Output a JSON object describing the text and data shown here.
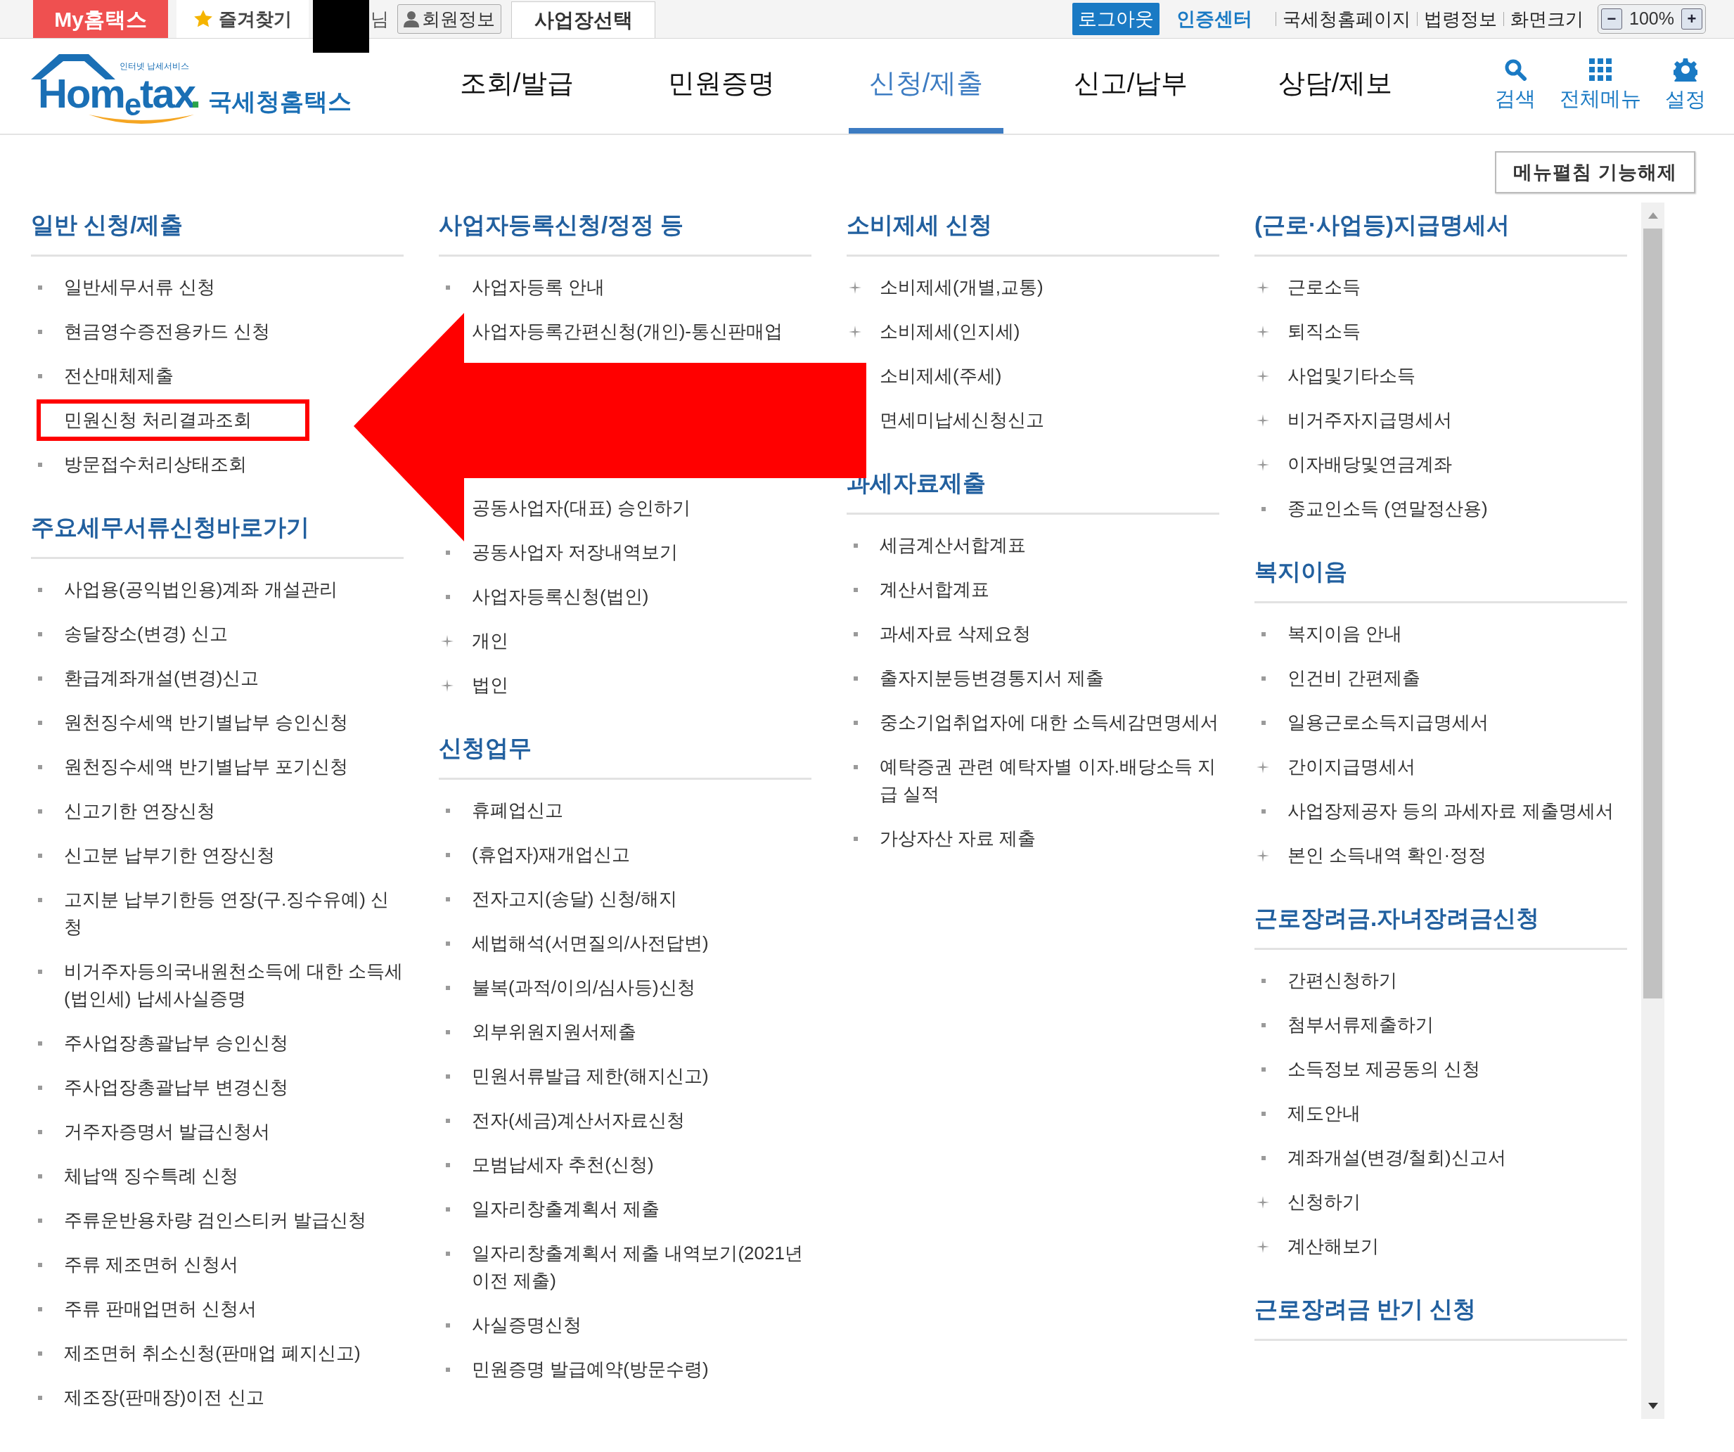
{
  "top_bar": {
    "my_hometax": "My홈택스",
    "favorites": "즐겨찾기",
    "user_suffix": "님",
    "member_info": "회원정보",
    "workplace_select": "사업장선택",
    "logout": "로그아웃",
    "cert_center": "인증센터",
    "links": [
      "국세청홈페이지",
      "법령정보",
      "화면크기"
    ],
    "zoom": {
      "minus": "−",
      "value": "100%",
      "plus": "+"
    }
  },
  "header": {
    "logo": {
      "word": "Hom$_{e}$tax",
      "dot": ".",
      "tagline": "인터넷 납세서비스",
      "name": "국세청홈택스"
    },
    "nav": [
      {
        "label": "조회/발급",
        "selected": false
      },
      {
        "label": "민원증명",
        "selected": false
      },
      {
        "label": "신청/제출",
        "selected": true
      },
      {
        "label": "신고/납부",
        "selected": false
      },
      {
        "label": "상담/제보",
        "selected": false
      }
    ],
    "tools": [
      {
        "kind": "search",
        "label": "검색"
      },
      {
        "kind": "grid",
        "label": "전체메뉴"
      },
      {
        "kind": "gear",
        "label": "설정"
      }
    ]
  },
  "menu_toggle": "메뉴펼침 기능해제",
  "columns": [
    {
      "sections": [
        {
          "title": "일반 신청/제출",
          "items": [
            {
              "label": "일반세무서류 신청",
              "kind": "square",
              "highlighted": false
            },
            {
              "label": "현금영수증전용카드 신청",
              "kind": "square",
              "highlighted": false
            },
            {
              "label": "전산매체제출",
              "kind": "square",
              "highlighted": false
            },
            {
              "label": "민원신청 처리결과조회",
              "kind": "none",
              "highlighted": true
            },
            {
              "label": "방문접수처리상태조회",
              "kind": "square",
              "highlighted": false
            }
          ]
        },
        {
          "title": "주요세무서류신청바로가기",
          "items": [
            {
              "label": "사업용(공익법인용)계좌 개설관리",
              "kind": "square",
              "highlighted": false
            },
            {
              "label": "송달장소(변경) 신고",
              "kind": "square",
              "highlighted": false
            },
            {
              "label": "환급계좌개설(변경)신고",
              "kind": "square",
              "highlighted": false
            },
            {
              "label": "원천징수세액 반기별납부 승인신청",
              "kind": "square",
              "highlighted": false
            },
            {
              "label": "원천징수세액 반기별납부 포기신청",
              "kind": "square",
              "highlighted": false
            },
            {
              "label": "신고기한 연장신청",
              "kind": "square",
              "highlighted": false
            },
            {
              "label": "신고분 납부기한 연장신청",
              "kind": "square",
              "highlighted": false
            },
            {
              "label": "고지분 납부기한등 연장(구.징수유예) 신청",
              "kind": "square",
              "highlighted": false
            },
            {
              "label": "비거주자등의국내원천소득에 대한 소득세(법인세) 납세사실증명",
              "kind": "square",
              "highlighted": false
            },
            {
              "label": "주사업장총괄납부 승인신청",
              "kind": "square",
              "highlighted": false
            },
            {
              "label": "주사업장총괄납부 변경신청",
              "kind": "square",
              "highlighted": false
            },
            {
              "label": "거주자증명서 발급신청서",
              "kind": "square",
              "highlighted": false
            },
            {
              "label": "체납액 징수특례 신청",
              "kind": "square",
              "highlighted": false
            },
            {
              "label": "주류운반용차량 검인스티커 발급신청",
              "kind": "square",
              "highlighted": false
            },
            {
              "label": "주류 제조면허 신청서",
              "kind": "square",
              "highlighted": false
            },
            {
              "label": "주류 판매업면허 신청서",
              "kind": "square",
              "highlighted": false
            },
            {
              "label": "제조면허 취소신청(판매업 폐지신고)",
              "kind": "square",
              "highlighted": false
            },
            {
              "label": "제조장(판매장)이전 신고",
              "kind": "square",
              "highlighted": false
            }
          ]
        }
      ]
    },
    {
      "sections": [
        {
          "title": "사업자등록신청/정정 등",
          "items": [
            {
              "label": "사업자등록 안내",
              "kind": "square",
              "highlighted": false
            },
            {
              "label": "사업자등록간편신청(개인)-통신판매업",
              "kind": "none",
              "highlighted": false
            },
            {
              "label": "공동사업자(대표) 승인하기",
              "kind": "none",
              "highlighted": false
            },
            {
              "label": "공동사업자 저장내역보기",
              "kind": "square",
              "highlighted": false
            },
            {
              "label": "사업자등록신청(법인)",
              "kind": "square",
              "highlighted": false
            },
            {
              "label": "개인",
              "kind": "plus",
              "highlighted": false
            },
            {
              "label": "법인",
              "kind": "plus",
              "highlighted": false
            }
          ]
        },
        {
          "title": "신청업무",
          "items": [
            {
              "label": "휴폐업신고",
              "kind": "square",
              "highlighted": false
            },
            {
              "label": "(휴업자)재개업신고",
              "kind": "square",
              "highlighted": false
            },
            {
              "label": "전자고지(송달) 신청/해지",
              "kind": "square",
              "highlighted": false
            },
            {
              "label": "세법해석(서면질의/사전답변)",
              "kind": "square",
              "highlighted": false
            },
            {
              "label": "불복(과적/이의/심사등)신청",
              "kind": "square",
              "highlighted": false
            },
            {
              "label": "외부위원지원서제출",
              "kind": "square",
              "highlighted": false
            },
            {
              "label": "민원서류발급 제한(해지신고)",
              "kind": "square",
              "highlighted": false
            },
            {
              "label": "전자(세금)계산서자료신청",
              "kind": "square",
              "highlighted": false
            },
            {
              "label": "모범납세자 추천(신청)",
              "kind": "square",
              "highlighted": false
            },
            {
              "label": "일자리창출계획서 제출",
              "kind": "square",
              "highlighted": false
            },
            {
              "label": "일자리창출계획서 제출 내역보기(2021년 이전 제출)",
              "kind": "square",
              "highlighted": false
            },
            {
              "label": "사실증명신청",
              "kind": "square",
              "highlighted": false
            },
            {
              "label": "민원증명 발급예약(방문수령)",
              "kind": "square",
              "highlighted": false
            }
          ]
        }
      ]
    },
    {
      "sections": [
        {
          "title": "소비제세 신청",
          "items": [
            {
              "label": "소비제세(개별,교통)",
              "kind": "plus",
              "highlighted": false
            },
            {
              "label": "소비제세(인지세)",
              "kind": "plus",
              "highlighted": false
            },
            {
              "label": "소비제세(주세)",
              "kind": "none",
              "highlighted": false
            },
            {
              "label": "면세미납세신청신고",
              "kind": "none",
              "highlighted": false
            }
          ]
        },
        {
          "title": "과세자료제출",
          "items": [
            {
              "label": "세금계산서합계표",
              "kind": "square",
              "highlighted": false
            },
            {
              "label": "계산서합계표",
              "kind": "square",
              "highlighted": false
            },
            {
              "label": "과세자료 삭제요청",
              "kind": "square",
              "highlighted": false
            },
            {
              "label": "출자지분등변경통지서 제출",
              "kind": "square",
              "highlighted": false
            },
            {
              "label": "중소기업취업자에 대한 소득세감면명세서",
              "kind": "square",
              "highlighted": false
            },
            {
              "label": "예탁증권 관련 예탁자별 이자.배당소득 지급 실적",
              "kind": "square",
              "highlighted": false
            },
            {
              "label": "가상자산 자료 제출",
              "kind": "square",
              "highlighted": false
            }
          ]
        }
      ]
    },
    {
      "sections": [
        {
          "title": "(근로·사업등)지급명세서",
          "items": [
            {
              "label": "근로소득",
              "kind": "plus",
              "highlighted": false
            },
            {
              "label": "퇴직소득",
              "kind": "plus",
              "highlighted": false
            },
            {
              "label": "사업및기타소득",
              "kind": "plus",
              "highlighted": false
            },
            {
              "label": "비거주자지급명세서",
              "kind": "plus",
              "highlighted": false
            },
            {
              "label": "이자배당및연금계좌",
              "kind": "plus",
              "highlighted": false
            },
            {
              "label": "종교인소득 (연말정산용)",
              "kind": "square",
              "highlighted": false
            }
          ]
        },
        {
          "title": "복지이음",
          "items": [
            {
              "label": "복지이음 안내",
              "kind": "square",
              "highlighted": false
            },
            {
              "label": "인건비 간편제출",
              "kind": "square",
              "highlighted": false
            },
            {
              "label": "일용근로소득지급명세서",
              "kind": "square",
              "highlighted": false
            },
            {
              "label": "간이지급명세서",
              "kind": "plus",
              "highlighted": false
            },
            {
              "label": "사업장제공자 등의 과세자료 제출명세서",
              "kind": "square",
              "highlighted": false
            },
            {
              "label": "본인 소득내역 확인·정정",
              "kind": "plus",
              "highlighted": false
            }
          ]
        },
        {
          "title": "근로장려금.자녀장려금신청",
          "items": [
            {
              "label": "간편신청하기",
              "kind": "square",
              "highlighted": false
            },
            {
              "label": "첨부서류제출하기",
              "kind": "square",
              "highlighted": false
            },
            {
              "label": "소득정보 제공동의 신청",
              "kind": "square",
              "highlighted": false
            },
            {
              "label": "제도안내",
              "kind": "square",
              "highlighted": false
            },
            {
              "label": "계좌개설(변경/철회)신고서",
              "kind": "square",
              "highlighted": false
            },
            {
              "label": "신청하기",
              "kind": "plus",
              "highlighted": false
            },
            {
              "label": "계산해보기",
              "kind": "plus",
              "highlighted": false
            }
          ]
        },
        {
          "title": "근로장려금 반기 신청"
        }
      ]
    }
  ]
}
